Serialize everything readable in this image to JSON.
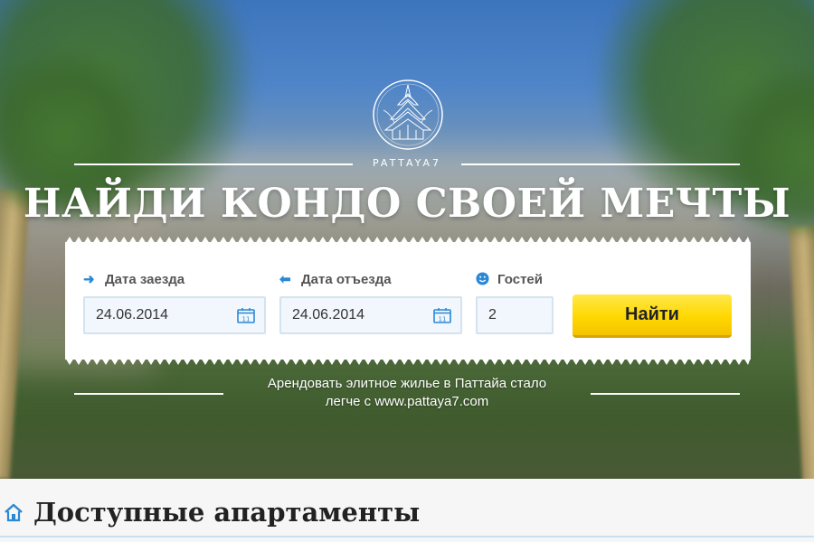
{
  "hero": {
    "brand": "PATTAYA7",
    "headline": "НАЙДИ КОНДО СВОЕЙ МЕЧТЫ",
    "tagline_line1": "Арендовать элитное жилье в Паттайа стало",
    "tagline_line2": "легче с www.pattaya7.com"
  },
  "search": {
    "checkin": {
      "label": "Дата заезда",
      "value": "24.06.2014",
      "icon": "arrow-right-icon"
    },
    "checkout": {
      "label": "Дата отъезда",
      "value": "24.06.2014",
      "icon": "arrow-left-icon"
    },
    "guests": {
      "label": "Гостей",
      "value": "2",
      "icon": "smiley-icon"
    },
    "calendar_day": "11",
    "submit_label": "Найти"
  },
  "section": {
    "title": "Доступные апартаменты",
    "icon": "home-icon"
  },
  "colors": {
    "accent_blue": "#2a88d6",
    "button_yellow": "#ffd800",
    "input_bg": "#f1f7fc",
    "input_border": "#d4e3f0"
  }
}
